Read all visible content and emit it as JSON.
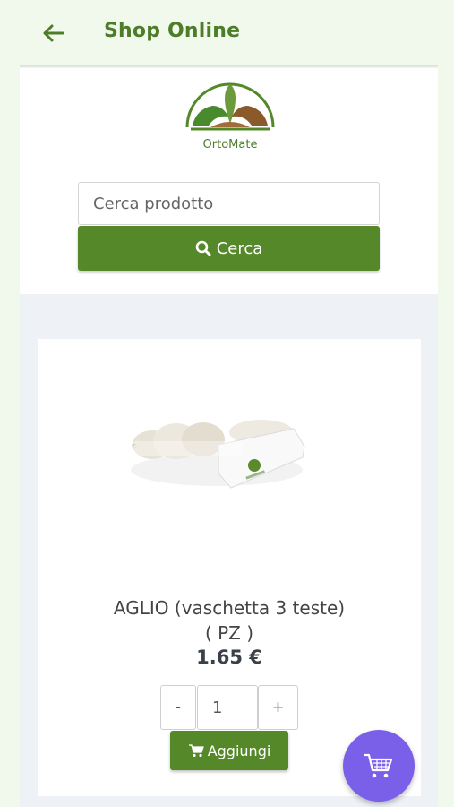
{
  "app_bar": {
    "title": "Shop Online",
    "back_icon": "arrow-left-icon"
  },
  "brand": {
    "logo_text": "OrtoMate"
  },
  "search": {
    "placeholder": "Cerca prodotto",
    "value": "",
    "button_label": "Cerca",
    "button_icon": "search-icon"
  },
  "product": {
    "name": "AGLIO (vaschetta 3 teste)",
    "unit": "( PZ )",
    "price": "1.65 €",
    "quantity": {
      "minus_label": "-",
      "value": "1",
      "plus_label": "+"
    },
    "add_label": "Aggiungi",
    "add_icon": "cart-icon"
  },
  "fab": {
    "icon": "shopping-cart-icon"
  },
  "colors": {
    "primary_green": "#548829",
    "title_green": "#4e7d2a",
    "fab_purple": "#7a5fe8",
    "app_bg": "#f1f8ec"
  }
}
